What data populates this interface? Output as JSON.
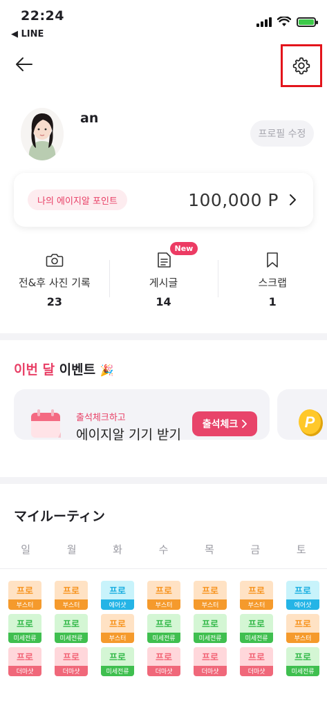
{
  "status_bar": {
    "time": "22:24",
    "back_app": "◀ LINE"
  },
  "profile": {
    "name": "an",
    "edit_label": "프로필 수정"
  },
  "points": {
    "badge": "나의 에이지알 포인트",
    "value": "100,000 P"
  },
  "stats": [
    {
      "label": "전&후 사진 기록",
      "count": "23",
      "icon": "camera-icon"
    },
    {
      "label": "게시글",
      "count": "14",
      "icon": "document-icon",
      "badge": "New"
    },
    {
      "label": "스크랩",
      "count": "1",
      "icon": "bookmark-icon"
    }
  ],
  "events": {
    "title_accent": "이번 달",
    "title_rest": " 이벤트",
    "title_emoji": "🎉",
    "card": {
      "subtitle": "출석체크하고",
      "title": "에이지알 기기 받기",
      "button": "출석체크"
    }
  },
  "routine": {
    "title": "マイルーティン",
    "weekdays": [
      "일",
      "월",
      "화",
      "수",
      "목",
      "금",
      "토"
    ],
    "tag_top": "프로",
    "labels": {
      "booster": "부스터",
      "air": "에어샷",
      "micro": "미세전류",
      "derma": "더마샷"
    },
    "grid": [
      [
        "booster",
        "booster",
        "air",
        "booster",
        "booster",
        "booster",
        "air"
      ],
      [
        "micro",
        "micro",
        "booster",
        "micro",
        "micro",
        "micro",
        "booster"
      ],
      [
        "derma",
        "derma",
        "micro",
        "derma",
        "derma",
        "derma",
        "micro"
      ]
    ]
  },
  "colors": {
    "accent": "#e83e65",
    "settings_highlight": "#e3141b"
  }
}
